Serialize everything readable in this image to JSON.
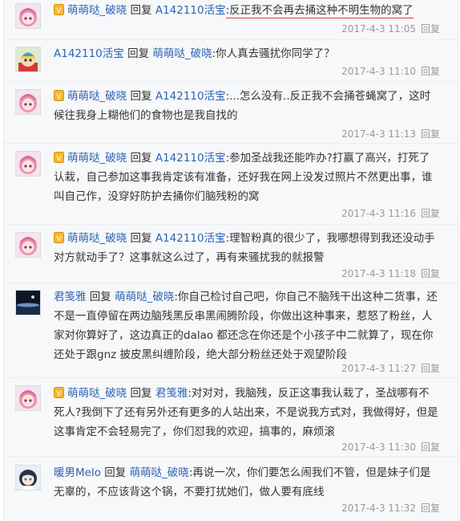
{
  "reply_word": "回复",
  "reply_link": "回复",
  "comments": [
    {
      "avatar": "pink-hair-anime-girl",
      "user": "萌萌哒_破晓",
      "vip": true,
      "target": "A142110活宝",
      "text": ":反正我不会再去捅这种不明生物的窝了",
      "time": "2017-4-3 11:05"
    },
    {
      "avatar": "cartoon-boy-cartman",
      "user": "A142110活宝",
      "vip": false,
      "target": "萌萌哒_破晓",
      "text": ":你人真去骚扰你同学了？",
      "time": "2017-4-3 11:10"
    },
    {
      "avatar": "pink-hair-anime-girl",
      "user": "萌萌哒_破晓",
      "vip": true,
      "target": "A142110活宝",
      "text": ":...怎么没有..反正我不会捅苍蝇窝了，这时候往我身上糊他们的食物也是我自找的",
      "time": "2017-4-3 11:13"
    },
    {
      "avatar": "pink-hair-anime-girl",
      "user": "萌萌哒_破晓",
      "vip": true,
      "target": "A142110活宝",
      "text": ":参加圣战我还能咋办?打赢了高兴，打死了认栽，自己参加这事我肯定该有准备，还好我在网上没发过照片不然更出事，谁叫自己作，没穿好防护去捅你们脑残粉的窝",
      "time": "2017-4-3 11:16"
    },
    {
      "avatar": "pink-hair-anime-girl",
      "user": "萌萌哒_破晓",
      "vip": true,
      "target": "A142110活宝",
      "text": ":理智粉真的很少了，我哪想得到我还没动手对方就动手了？这事就这么过了，再有来骚扰我的就报警",
      "time": "2017-4-3 11:18"
    },
    {
      "avatar": "dark-night-sky",
      "user": "君笺雅",
      "vip": false,
      "target": "萌萌哒_破晓",
      "text": ":你自己检讨自己吧，你自己不脑残干出这种二货事，还不是一直停留在两边脑残黑反串黑闹腾阶段，你做出这种事来，惹怒了粉丝，人家对你算好了，这边真正的dalao 都还念在你还是个小孩子中二就算了，现在你还处于跟gnz 披皮黑纠缠阶段，绝大部分粉丝还处于观望阶段",
      "time": "2017-4-3 11:27"
    },
    {
      "avatar": "pink-hair-anime-girl",
      "user": "萌萌哒_破晓",
      "vip": true,
      "target": "君笺雅",
      "text": ":对对对，我脑残，反正这事我认栽了，圣战哪有不死人?我倒下了还有另外还有更多的人站出来，不是说我方式对，我做得好，但是这事肯定不会轻易完了，你们怼我的欢迎，搞事的，麻烦滚",
      "time": "2017-4-3 11:30"
    },
    {
      "avatar": "anime-girl-dark-hair",
      "user": "暖男Melo",
      "vip": false,
      "target": "萌萌哒_破晓",
      "text": ":再说一次，你们要怎么闹我们不管，但是妹子们是无辜的，不应该背这个锅，不要打扰她们，做人要有底线",
      "time": "2017-4-3 11:32"
    }
  ]
}
